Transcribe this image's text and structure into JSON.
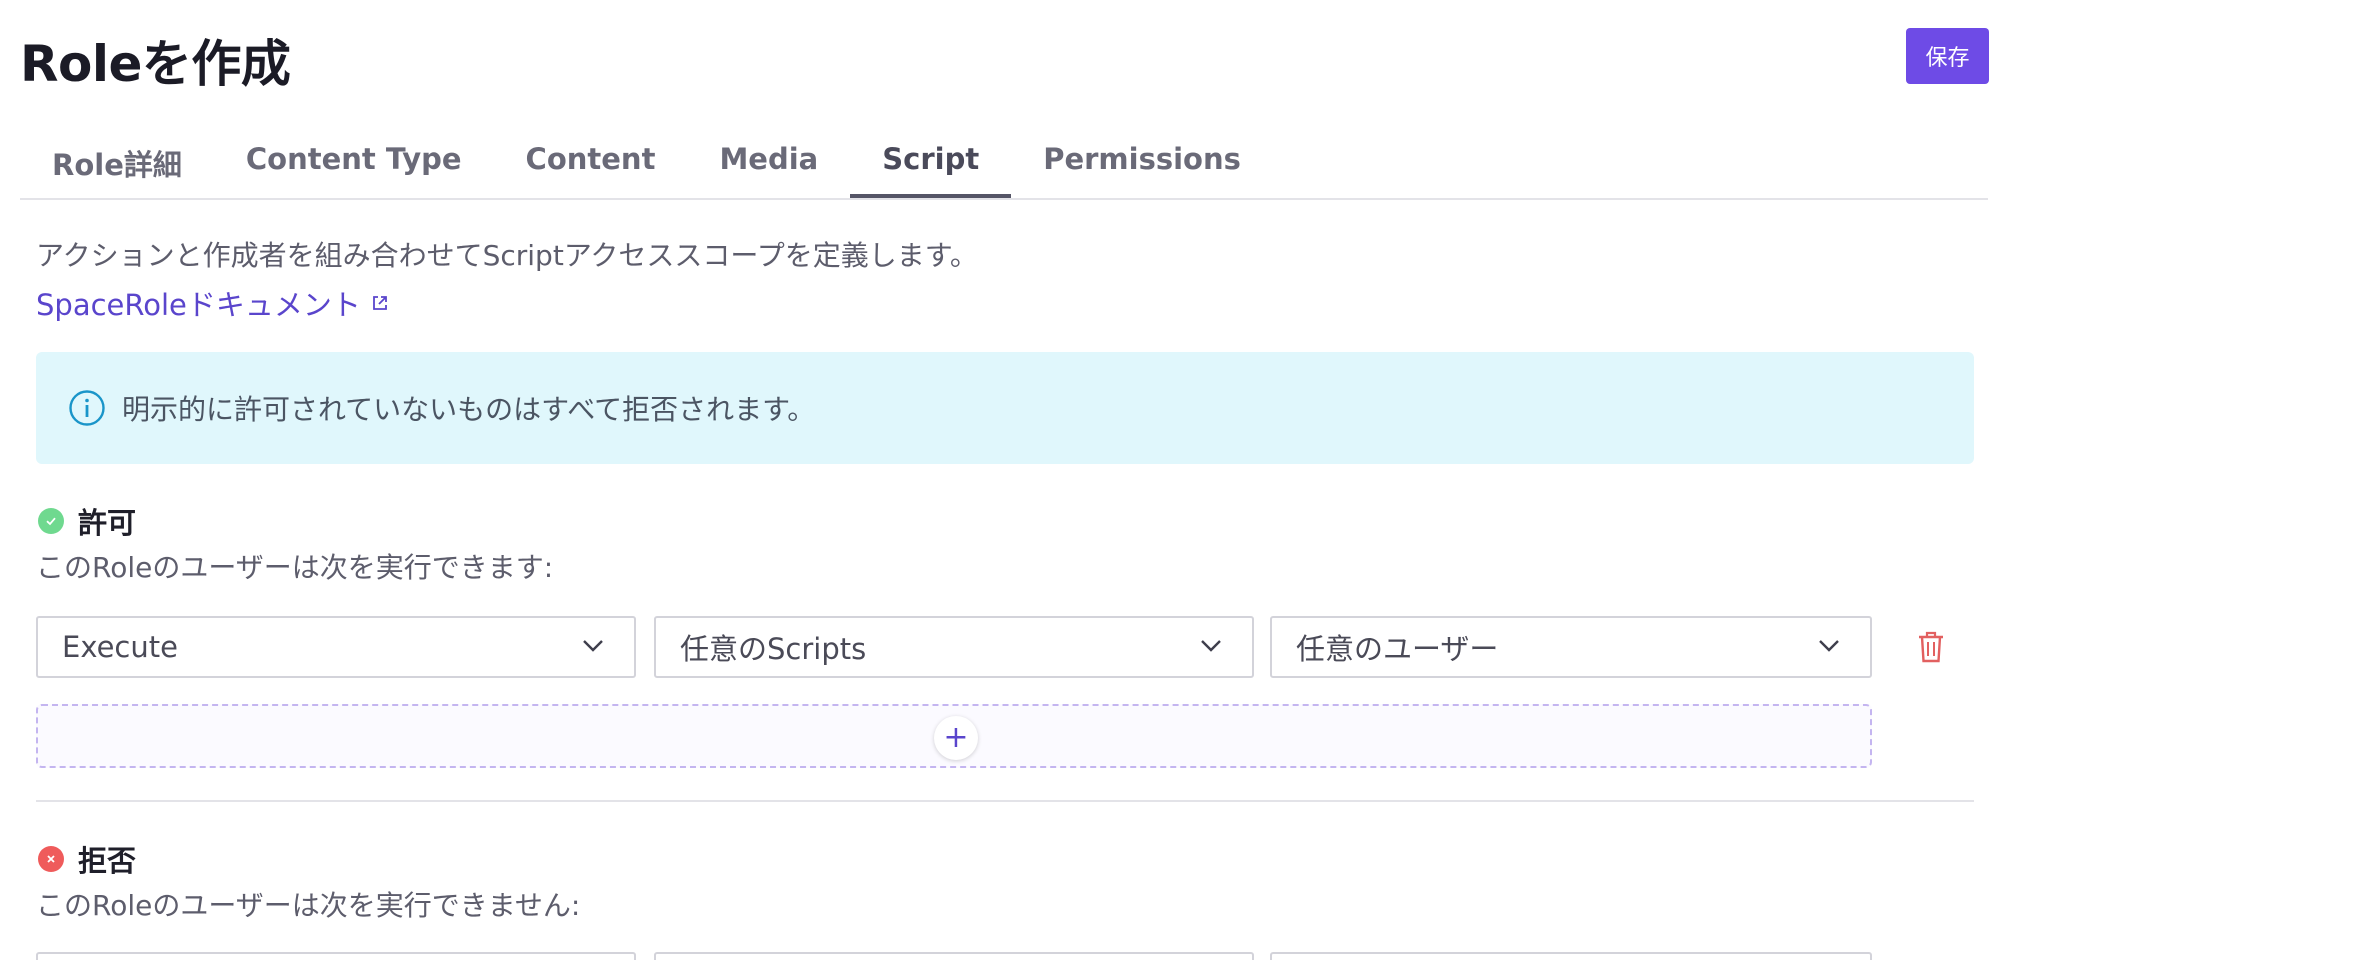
{
  "page": {
    "title": "Roleを作成",
    "save_label": "保存"
  },
  "tabs": [
    {
      "label": "Role詳細",
      "active": false
    },
    {
      "label": "Content Type",
      "active": false
    },
    {
      "label": "Content",
      "active": false
    },
    {
      "label": "Media",
      "active": false
    },
    {
      "label": "Script",
      "active": true
    },
    {
      "label": "Permissions",
      "active": false
    }
  ],
  "description": "アクションと作成者を組み合わせてScriptアクセススコープを定義します。",
  "doc_link": {
    "label": "SpaceRoleドキュメント",
    "icon": "external-link-icon"
  },
  "info": {
    "icon": "info-icon",
    "text": "明示的に許可されていないものはすべて拒否されます。"
  },
  "allow": {
    "title": "許可",
    "subtitle": "このRoleのユーザーは次を実行できます:",
    "icon": "check-circle-icon",
    "color": "#6fd98f",
    "rule": {
      "action": "Execute",
      "target": "任意のScripts",
      "author": "任意のユーザー"
    },
    "add_label": "+"
  },
  "deny": {
    "title": "拒否",
    "subtitle": "このRoleのユーザーは次を実行できません:",
    "icon": "x-circle-icon",
    "color": "#ef5b5b"
  },
  "colors": {
    "accent": "#6e4be6",
    "link": "#5a45cc",
    "info_bg": "#e0f7fc",
    "info_icon": "#1a95c9",
    "danger": "#e26060"
  }
}
